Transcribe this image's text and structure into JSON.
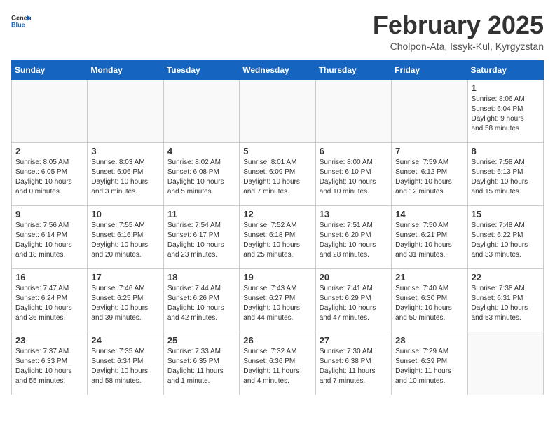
{
  "header": {
    "logo_general": "General",
    "logo_blue": "Blue",
    "title": "February 2025",
    "subtitle": "Cholpon-Ata, Issyk-Kul, Kyrgyzstan"
  },
  "weekdays": [
    "Sunday",
    "Monday",
    "Tuesday",
    "Wednesday",
    "Thursday",
    "Friday",
    "Saturday"
  ],
  "weeks": [
    [
      {
        "day": "",
        "info": ""
      },
      {
        "day": "",
        "info": ""
      },
      {
        "day": "",
        "info": ""
      },
      {
        "day": "",
        "info": ""
      },
      {
        "day": "",
        "info": ""
      },
      {
        "day": "",
        "info": ""
      },
      {
        "day": "1",
        "info": "Sunrise: 8:06 AM\nSunset: 6:04 PM\nDaylight: 9 hours\nand 58 minutes."
      }
    ],
    [
      {
        "day": "2",
        "info": "Sunrise: 8:05 AM\nSunset: 6:05 PM\nDaylight: 10 hours\nand 0 minutes."
      },
      {
        "day": "3",
        "info": "Sunrise: 8:03 AM\nSunset: 6:06 PM\nDaylight: 10 hours\nand 3 minutes."
      },
      {
        "day": "4",
        "info": "Sunrise: 8:02 AM\nSunset: 6:08 PM\nDaylight: 10 hours\nand 5 minutes."
      },
      {
        "day": "5",
        "info": "Sunrise: 8:01 AM\nSunset: 6:09 PM\nDaylight: 10 hours\nand 7 minutes."
      },
      {
        "day": "6",
        "info": "Sunrise: 8:00 AM\nSunset: 6:10 PM\nDaylight: 10 hours\nand 10 minutes."
      },
      {
        "day": "7",
        "info": "Sunrise: 7:59 AM\nSunset: 6:12 PM\nDaylight: 10 hours\nand 12 minutes."
      },
      {
        "day": "8",
        "info": "Sunrise: 7:58 AM\nSunset: 6:13 PM\nDaylight: 10 hours\nand 15 minutes."
      }
    ],
    [
      {
        "day": "9",
        "info": "Sunrise: 7:56 AM\nSunset: 6:14 PM\nDaylight: 10 hours\nand 18 minutes."
      },
      {
        "day": "10",
        "info": "Sunrise: 7:55 AM\nSunset: 6:16 PM\nDaylight: 10 hours\nand 20 minutes."
      },
      {
        "day": "11",
        "info": "Sunrise: 7:54 AM\nSunset: 6:17 PM\nDaylight: 10 hours\nand 23 minutes."
      },
      {
        "day": "12",
        "info": "Sunrise: 7:52 AM\nSunset: 6:18 PM\nDaylight: 10 hours\nand 25 minutes."
      },
      {
        "day": "13",
        "info": "Sunrise: 7:51 AM\nSunset: 6:20 PM\nDaylight: 10 hours\nand 28 minutes."
      },
      {
        "day": "14",
        "info": "Sunrise: 7:50 AM\nSunset: 6:21 PM\nDaylight: 10 hours\nand 31 minutes."
      },
      {
        "day": "15",
        "info": "Sunrise: 7:48 AM\nSunset: 6:22 PM\nDaylight: 10 hours\nand 33 minutes."
      }
    ],
    [
      {
        "day": "16",
        "info": "Sunrise: 7:47 AM\nSunset: 6:24 PM\nDaylight: 10 hours\nand 36 minutes."
      },
      {
        "day": "17",
        "info": "Sunrise: 7:46 AM\nSunset: 6:25 PM\nDaylight: 10 hours\nand 39 minutes."
      },
      {
        "day": "18",
        "info": "Sunrise: 7:44 AM\nSunset: 6:26 PM\nDaylight: 10 hours\nand 42 minutes."
      },
      {
        "day": "19",
        "info": "Sunrise: 7:43 AM\nSunset: 6:27 PM\nDaylight: 10 hours\nand 44 minutes."
      },
      {
        "day": "20",
        "info": "Sunrise: 7:41 AM\nSunset: 6:29 PM\nDaylight: 10 hours\nand 47 minutes."
      },
      {
        "day": "21",
        "info": "Sunrise: 7:40 AM\nSunset: 6:30 PM\nDaylight: 10 hours\nand 50 minutes."
      },
      {
        "day": "22",
        "info": "Sunrise: 7:38 AM\nSunset: 6:31 PM\nDaylight: 10 hours\nand 53 minutes."
      }
    ],
    [
      {
        "day": "23",
        "info": "Sunrise: 7:37 AM\nSunset: 6:33 PM\nDaylight: 10 hours\nand 55 minutes."
      },
      {
        "day": "24",
        "info": "Sunrise: 7:35 AM\nSunset: 6:34 PM\nDaylight: 10 hours\nand 58 minutes."
      },
      {
        "day": "25",
        "info": "Sunrise: 7:33 AM\nSunset: 6:35 PM\nDaylight: 11 hours\nand 1 minute."
      },
      {
        "day": "26",
        "info": "Sunrise: 7:32 AM\nSunset: 6:36 PM\nDaylight: 11 hours\nand 4 minutes."
      },
      {
        "day": "27",
        "info": "Sunrise: 7:30 AM\nSunset: 6:38 PM\nDaylight: 11 hours\nand 7 minutes."
      },
      {
        "day": "28",
        "info": "Sunrise: 7:29 AM\nSunset: 6:39 PM\nDaylight: 11 hours\nand 10 minutes."
      },
      {
        "day": "",
        "info": ""
      }
    ]
  ]
}
